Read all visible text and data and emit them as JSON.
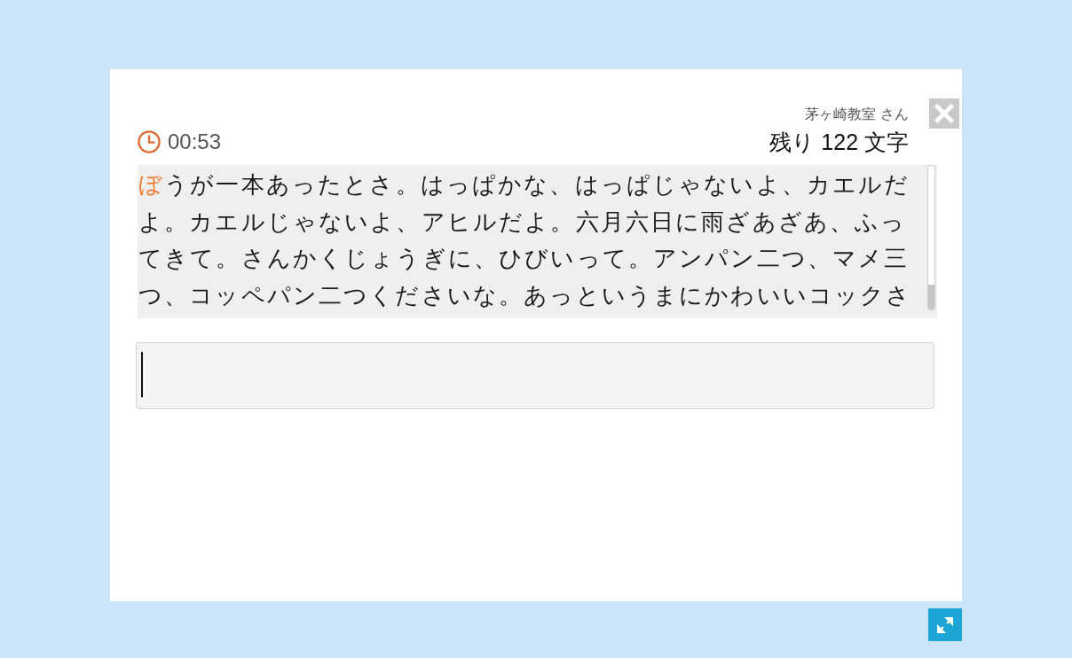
{
  "timer": {
    "time": "00:53"
  },
  "user": {
    "label": "茅ヶ崎教室 さん"
  },
  "remaining": {
    "label": "残り 122 文字"
  },
  "passage": {
    "current": "ぼ",
    "upcoming": "うが一本あったとさ。はっぱかな、はっぱじゃないよ、カエルだよ。カエルじゃないよ、アヒルだよ。六月六日に雨ざあざあ、ふってきて。さんかくじょうぎに、ひびいって。アンパン二つ、マメ三つ、コッペパン二つくださいな。あっというまにかわいいコックさ"
  }
}
